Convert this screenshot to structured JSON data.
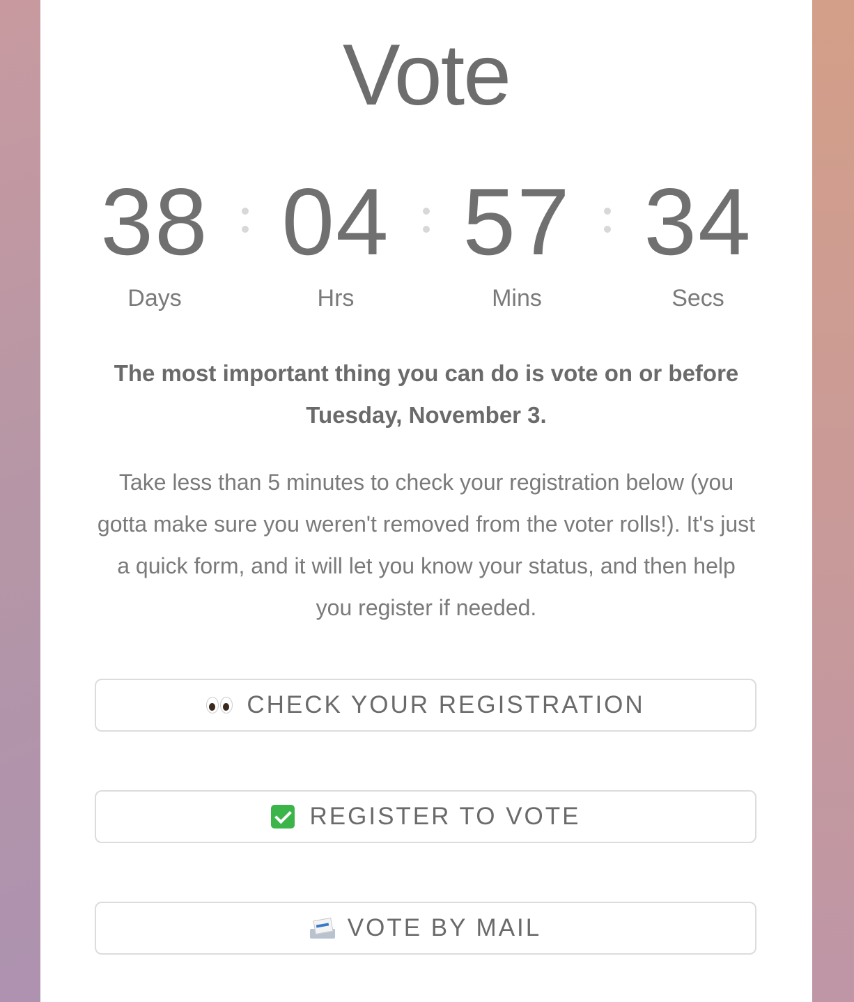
{
  "page": {
    "title": "Vote"
  },
  "countdown": {
    "days": {
      "value": "38",
      "label": "Days"
    },
    "hours": {
      "value": "04",
      "label": "Hrs"
    },
    "minutes": {
      "value": "57",
      "label": "Mins"
    },
    "seconds": {
      "value": "34",
      "label": "Secs"
    }
  },
  "content": {
    "headline": "The most important thing you can do is vote on or before Tuesday, November 3.",
    "body": "Take less than 5 minutes to check your registration below (you gotta make sure you weren't removed from the voter rolls!). It's just a quick form, and it will let you know your status, and then help you register if needed."
  },
  "actions": {
    "check_registration": {
      "label": "CHECK YOUR REGISTRATION",
      "icon": "eyes-icon"
    },
    "register": {
      "label": "REGISTER TO VOTE",
      "icon": "check-mark-icon"
    },
    "vote_by_mail": {
      "label": "VOTE BY MAIL",
      "icon": "incoming-envelope-icon"
    }
  },
  "colors": {
    "text": "#707070",
    "button_border": "#dcdcdc",
    "check_green": "#3bb54a"
  }
}
